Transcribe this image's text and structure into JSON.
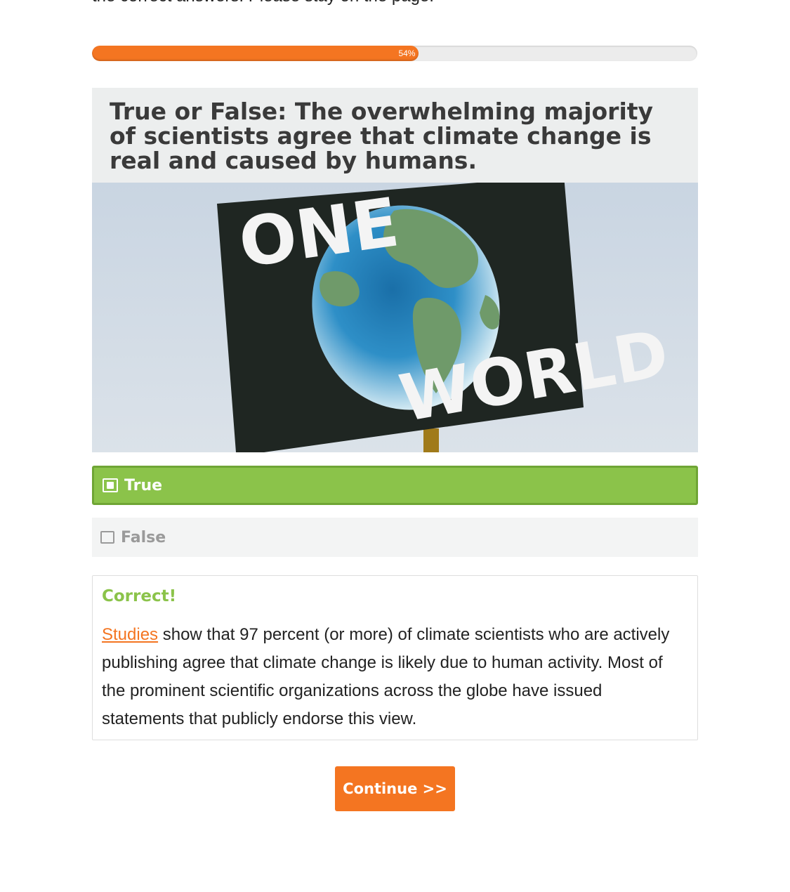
{
  "intro": {
    "text": "the correct answers. Please stay on the page."
  },
  "progress": {
    "percent": 54,
    "label": "54%",
    "fill_color": "#f47521"
  },
  "question": {
    "title": "True or False: The overwhelming majority of scientists agree that climate change is real and caused by humans.",
    "image": {
      "sign_text_top": "ONE",
      "sign_text_bottom": "WORLD"
    }
  },
  "answers": [
    {
      "label": "True",
      "selected": true,
      "state": "correct"
    },
    {
      "label": "False",
      "selected": false,
      "state": "unselected"
    }
  ],
  "feedback": {
    "heading": "Correct!",
    "link_text": "Studies",
    "body": " show that 97 percent (or more) of climate scientists who are actively publishing agree that climate change is likely due to human activity. Most of the prominent scientific organizations across the globe have issued statements that publicly endorse this view."
  },
  "continue_button": {
    "label": "Continue >>"
  },
  "colors": {
    "accent": "#f47521",
    "correct": "#8bc34a"
  }
}
